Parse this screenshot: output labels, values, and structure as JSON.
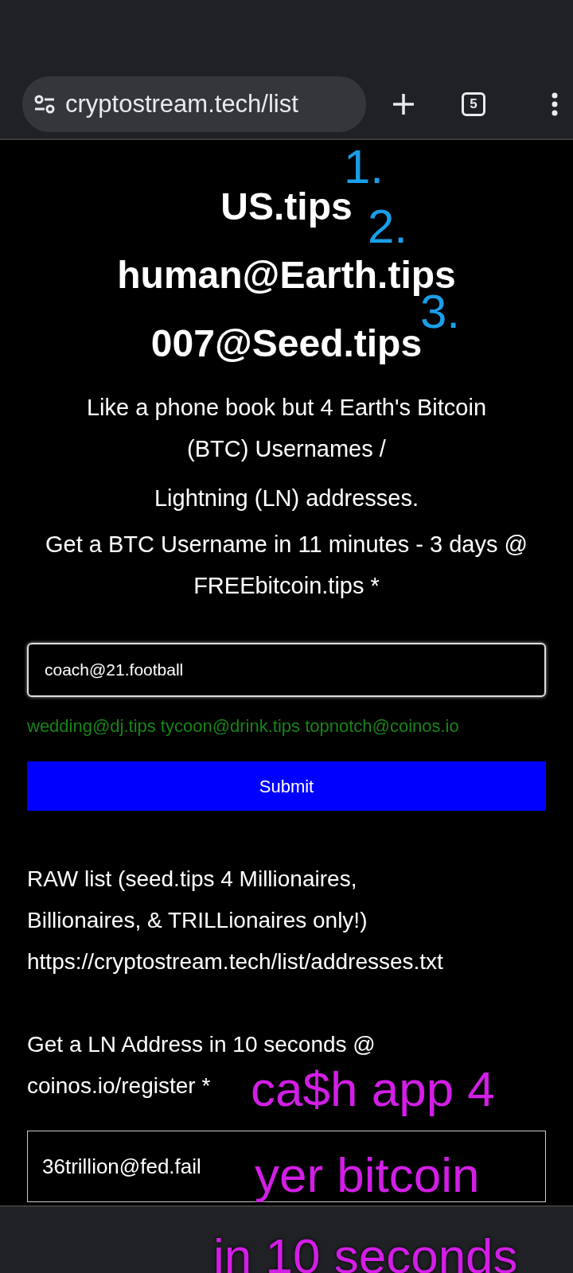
{
  "browser": {
    "url": "cryptostream.tech/list",
    "tab_count": "5"
  },
  "headings": [
    "US.tips",
    "human@Earth.tips",
    "007@Seed.tips"
  ],
  "intro": [
    "Like a phone book but 4 Earth's Bitcoin (BTC) Usernames /",
    "Lightning (LN) addresses.",
    "Get a BTC Username in 11 minutes - 3 days @ FREEbitcoin.tips *"
  ],
  "username_field": {
    "value": "coach@21.football"
  },
  "examples": "wedding@dj.tips tycoon@drink.tips topnotch@coinos.io",
  "submit": "Submit",
  "raw_list": [
    "RAW list (seed.tips 4 Millionaires, Billionaires, & TRILLionaires only!)",
    "https://cryptostream.tech/list/addresses.txt"
  ],
  "ln_text": [
    "Get a LN Address in 10 seconds @",
    "coinos.io/register *"
  ],
  "ln_field": {
    "value": "36trillion@fed.fail"
  },
  "annotations": {
    "numbers": [
      "1.",
      "2.",
      "3."
    ],
    "caption": [
      "ca$h app 4",
      "yer bitcoin",
      "in 10 seconds"
    ]
  }
}
